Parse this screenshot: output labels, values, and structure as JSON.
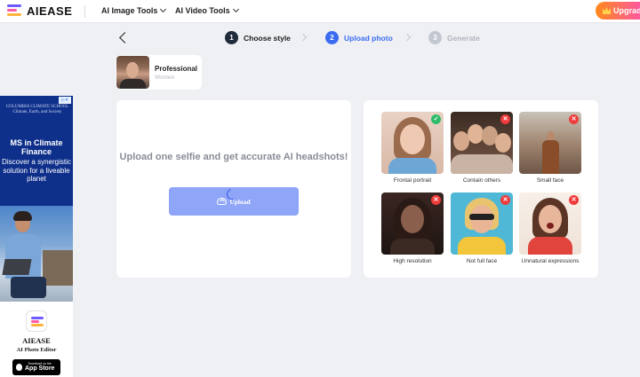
{
  "brand": {
    "name": "AIEASE"
  },
  "nav": {
    "items": [
      {
        "label": "AI Image Tools"
      },
      {
        "label": "AI Video Tools"
      }
    ],
    "upgrade_label": "Upgrade"
  },
  "steps": [
    {
      "num": "1",
      "label": "Choose style",
      "state": "done"
    },
    {
      "num": "2",
      "label": "Upload photo",
      "state": "active"
    },
    {
      "num": "3",
      "label": "Generate",
      "state": "pending"
    }
  ],
  "colors": {
    "done": "#1f2a3a",
    "active": "#3b6cf0",
    "pending": "#c3c7d2"
  },
  "style_chip": {
    "title": "Professional",
    "subtitle": "Women"
  },
  "ad": {
    "school": "COLUMBIA CLIMATE SCHOOL\nClimate, Earth, and Society",
    "headline": "MS in Climate Finance",
    "body": "Discover a synergistic solution for a liveable planet",
    "app_name": "AIEASE",
    "app_sub": "AI Photo Editor",
    "store_small": "Download on the",
    "store_big": "App Store"
  },
  "upload": {
    "message": "Upload one selfie and get accurate AI headshots!",
    "button_label": "Upload"
  },
  "examples": [
    {
      "label": "Frontal portrait",
      "status": "ok"
    },
    {
      "label": "Contain others",
      "status": "no"
    },
    {
      "label": "Small face",
      "status": "no"
    },
    {
      "label": "High resolution",
      "status": "no"
    },
    {
      "label": "Not full face",
      "status": "no"
    },
    {
      "label": "Unnatural expressions",
      "status": "no"
    }
  ]
}
